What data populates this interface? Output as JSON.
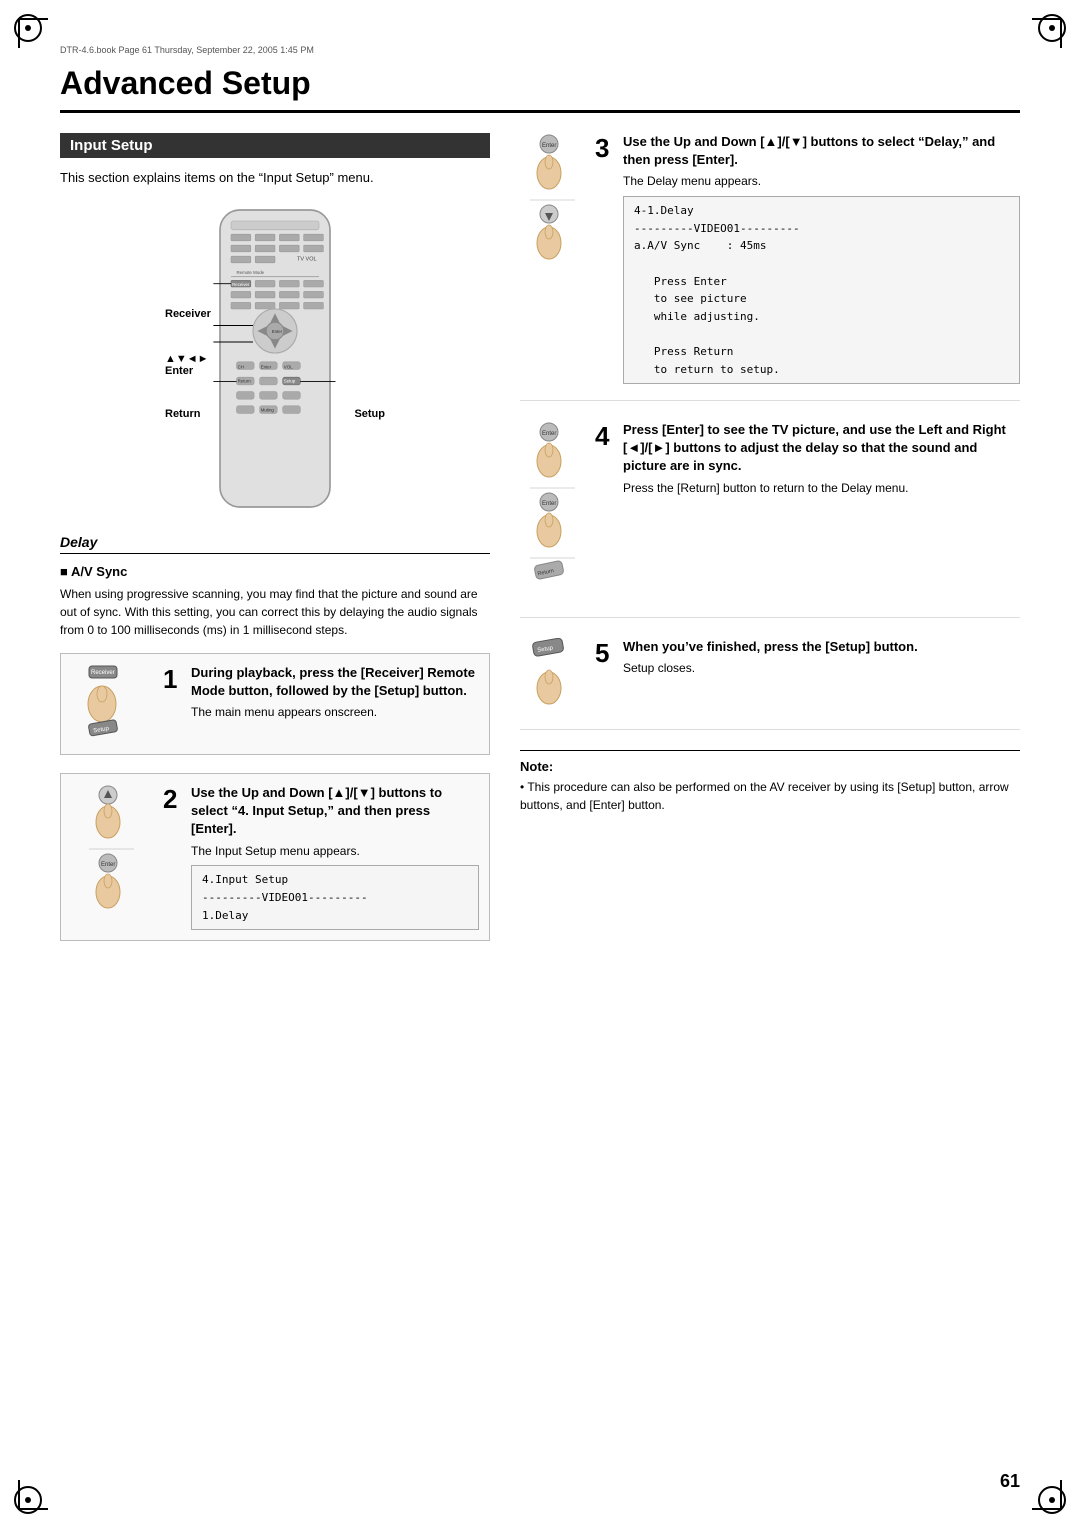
{
  "meta": {
    "header_line": "DTR-4.6.book  Page 61  Thursday, September 22, 2005  1:45 PM",
    "page_title": "Advanced Setup",
    "page_number": "61"
  },
  "left": {
    "section_header": "Input Setup",
    "section_desc": "This section explains items on the “Input Setup” menu.",
    "remote_labels": {
      "receiver": "Receiver",
      "arrows": "▲▼◄►",
      "enter": "Enter",
      "return": "Return",
      "setup": "Setup"
    },
    "delay": {
      "title": "Delay",
      "av_sync_title": "A/V Sync",
      "av_sync_desc": "When using progressive scanning, you may find that the picture and sound are out of sync. With this setting, you can correct this by delaying the audio signals from 0 to 100 milliseconds (ms) in 1 millisecond steps."
    },
    "step1": {
      "num": "1",
      "bold": "During playback, press the [Receiver] Remote Mode button, followed by the [Setup] button.",
      "normal": "The main menu appears onscreen."
    },
    "step2": {
      "num": "2",
      "bold": "Use the Up and Down [▲]/[▼] buttons to select “4. Input Setup,” and then press [Enter].",
      "normal": "The Input Setup menu appears.",
      "menu": "4.Input Setup\n---------VIDEO01---------\n1.Delay"
    }
  },
  "right": {
    "step3": {
      "num": "3",
      "bold": "Use the Up and Down [▲]/[▼] buttons to select “Delay,” and then press [Enter].",
      "normal": "The Delay menu appears.",
      "menu": "4-1.Delay\n---------VIDEO01---------\na.A/V Sync    : 45ms\n\n   Press Enter\n   to see picture\n   while adjusting.\n\n   Press Return\n   to return to setup."
    },
    "step4": {
      "num": "4",
      "bold": "Press [Enter] to see the TV picture, and use the Left and Right [◄]/[►] buttons to adjust the delay so that the sound and picture are in sync.",
      "normal": "Press the [Return] button to return to the Delay menu."
    },
    "step5": {
      "num": "5",
      "bold": "When you’ve finished, press the [Setup] button.",
      "normal": "Setup closes."
    },
    "note": {
      "title": "Note:",
      "text": "This procedure can also be performed on the AV receiver by using its [Setup] button, arrow buttons, and [Enter] button."
    }
  }
}
